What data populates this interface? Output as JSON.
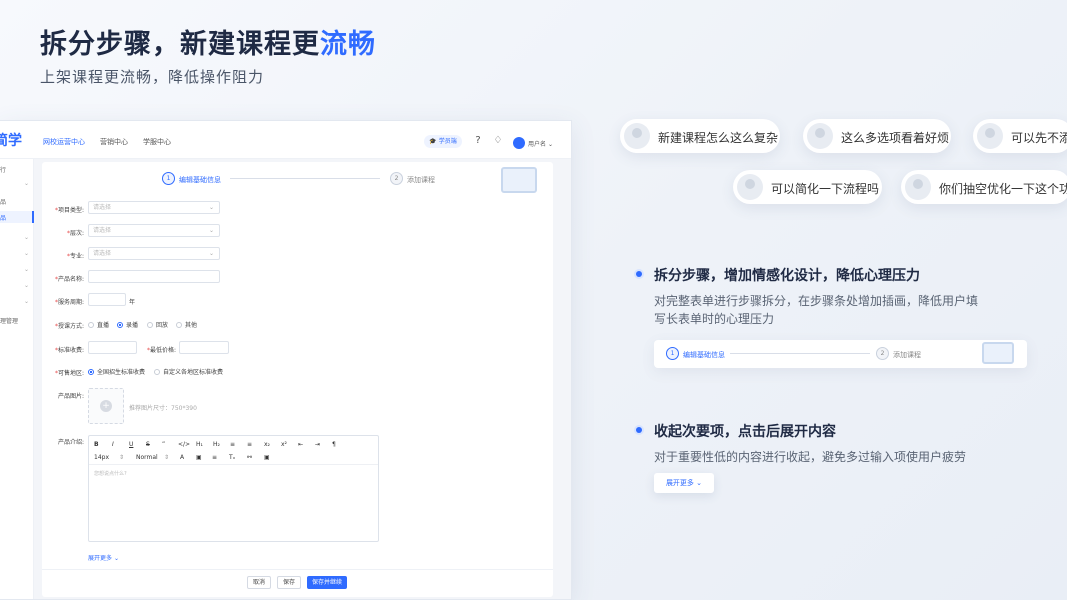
{
  "hero": {
    "title_main": "拆分步骤，新建课程更",
    "title_accent": "流畅",
    "subtitle": "上架课程更流畅，降低操作阻力"
  },
  "app": {
    "logo": "简学",
    "nav": [
      "网校运营中心",
      "营销中心",
      "学服中心"
    ],
    "badge": "学员端",
    "user_name": "用户名",
    "sidebar": [
      "行",
      "",
      "品",
      "品",
      "",
      "",
      "",
      "",
      "",
      "理管理"
    ],
    "steps": {
      "step1_num": "1",
      "step1_label": "编辑基础信息",
      "step2_num": "2",
      "step2_label": "添加课程"
    },
    "form": {
      "project_type_label": "项目类型:",
      "level_label": "层次:",
      "major_label": "专业:",
      "product_name_label": "产品名称:",
      "service_period_label": "服务周期:",
      "service_period_unit": "年",
      "teaching_mode_label": "授课方式:",
      "teaching_modes": [
        "直播",
        "录播",
        "回放",
        "其他"
      ],
      "standard_fee_label": "标准收费:",
      "min_price_label": "最低价格:",
      "region_label": "可售地区:",
      "regions": [
        "全国招生标准收费",
        "自定义各地区标准收费"
      ],
      "product_image_label": "产品图片:",
      "image_hint": "推荐图片尺寸：750*390",
      "product_intro_label": "产品介绍:",
      "select_placeholder": "请选择",
      "editor_placeholder": "您想说点什么?",
      "font_size": "14px",
      "font_style": "Normal",
      "expand_more": "展开更多",
      "buttons": {
        "cancel": "取消",
        "save": "保存",
        "save_continue": "保存并继续"
      }
    }
  },
  "bubbles": [
    "新建课程怎么这么复杂",
    "这么多选项看着好烦",
    "可以先不添",
    "可以简化一下流程吗",
    "你们抽空优化一下这个功能"
  ],
  "features": [
    {
      "title": "拆分步骤，增加情感化设计，降低心理压力",
      "desc_line1": "对完整表单进行步骤拆分，在步骤条处增加插画，降低用户填",
      "desc_line2": "写长表单时的心理压力"
    },
    {
      "title": "收起次要项，点击后展开内容",
      "desc_line1": "对于重要性低的内容进行收起，避免多过输入项使用户疲劳"
    }
  ],
  "colors": {
    "accent": "#2f6bff",
    "title": "#1f2a44"
  }
}
